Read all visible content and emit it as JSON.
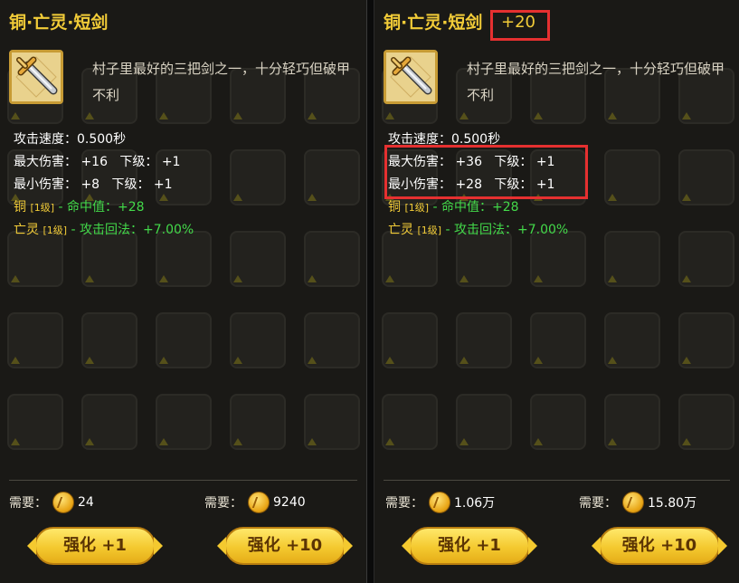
{
  "left": {
    "title": "铜·亡灵·短剑",
    "description": "村子里最好的三把剑之一，十分轻巧但破甲不利",
    "stats": {
      "attack_speed_label": "攻击速度：",
      "attack_speed_value": "0.500秒",
      "max_damage_label": "最大伤害：",
      "max_damage_value": "+16",
      "max_next_label": "下级：",
      "max_next_value": "+1",
      "min_damage_label": "最小伤害：",
      "min_damage_value": "+8",
      "min_next_label": "下级：",
      "min_next_value": "+1"
    },
    "affixes": [
      {
        "name": "铜",
        "level": "[1级]",
        "effect": "- 命中值：+28"
      },
      {
        "name": "亡灵",
        "level": "[1级]",
        "effect": "- 攻击回法：+7.00%"
      }
    ],
    "cost1": {
      "label": "需要：",
      "value": "24"
    },
    "cost2": {
      "label": "需要：",
      "value": "9240"
    },
    "btn1": "强化 +1",
    "btn2": "强化 +10"
  },
  "right": {
    "title": "铜·亡灵·短剑",
    "level_plus": "+20",
    "description": "村子里最好的三把剑之一，十分轻巧但破甲不利",
    "stats": {
      "attack_speed_label": "攻击速度：",
      "attack_speed_value": "0.500秒",
      "max_damage_label": "最大伤害：",
      "max_damage_value": "+36",
      "max_next_label": "下级：",
      "max_next_value": "+1",
      "min_damage_label": "最小伤害：",
      "min_damage_value": "+28",
      "min_next_label": "下级：",
      "min_next_value": "+1"
    },
    "affixes": [
      {
        "name": "铜",
        "level": "[1级]",
        "effect": "- 命中值：+28"
      },
      {
        "name": "亡灵",
        "level": "[1级]",
        "effect": "- 攻击回法：+7.00%"
      }
    ],
    "cost1": {
      "label": "需要：",
      "value": "1.06万"
    },
    "cost2": {
      "label": "需要：",
      "value": "15.80万"
    },
    "btn1": "强化 +1",
    "btn2": "强化 +10"
  },
  "colors": {
    "title_gold": "#f2cc38",
    "affix_green": "#43d94a",
    "highlight_red": "#e53030",
    "button_gold": "#f4c92f"
  },
  "icons": {
    "item": "short-sword-icon",
    "currency": "gold-coin-icon"
  }
}
